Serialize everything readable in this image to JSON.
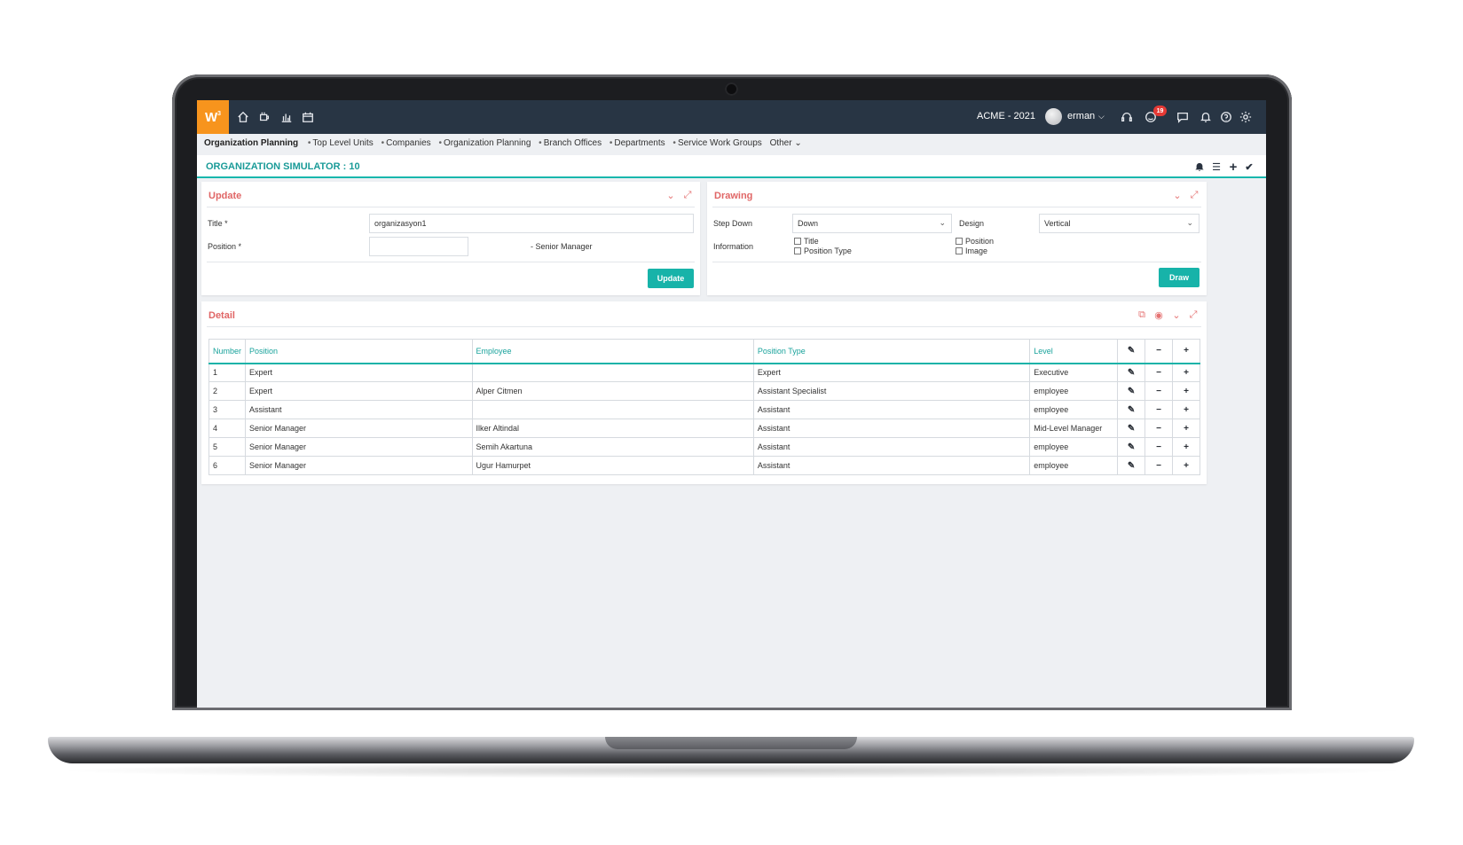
{
  "app": {
    "logo": "W",
    "logo_sup": "3",
    "company": "ACME - 2021",
    "user": "erman",
    "notification_count": "19"
  },
  "breadcrumb": {
    "items": [
      "Organization Planning",
      "Top Level Units",
      "Companies",
      "Organization Planning",
      "Branch Offices",
      "Departments",
      "Service Work Groups",
      "Other"
    ]
  },
  "page": {
    "title": "ORGANIZATION SIMULATOR : 10"
  },
  "update_panel": {
    "title": "Update",
    "title_label": "Title *",
    "title_value": "organizasyon1",
    "position_label": "Position *",
    "position_value": "",
    "position_text": "- Senior Manager",
    "button": "Update"
  },
  "drawing_panel": {
    "title": "Drawing",
    "step_down_label": "Step Down",
    "step_down_value": "Down",
    "design_label": "Design",
    "design_value": "Vertical",
    "information_label": "Information",
    "checkboxes": [
      "Title",
      "Position Type",
      "Position",
      "Image"
    ],
    "button": "Draw"
  },
  "detail_panel": {
    "title": "Detail",
    "columns": [
      "Number",
      "Position",
      "Employee",
      "Position Type",
      "Level"
    ],
    "rows": [
      {
        "number": "1",
        "position": "Expert",
        "employee": "",
        "position_type": "Expert",
        "level": "Executive"
      },
      {
        "number": "2",
        "position": "Expert",
        "employee": "Alper Citmen",
        "position_type": "Assistant Specialist",
        "level": "employee"
      },
      {
        "number": "3",
        "position": "Assistant",
        "employee": "",
        "position_type": "Assistant",
        "level": "employee"
      },
      {
        "number": "4",
        "position": "Senior Manager",
        "employee": "Ilker Altindal",
        "position_type": "Assistant",
        "level": "Mid-Level Manager"
      },
      {
        "number": "5",
        "position": "Senior Manager",
        "employee": "Semih Akartuna",
        "position_type": "Assistant",
        "level": "employee"
      },
      {
        "number": "6",
        "position": "Senior Manager",
        "employee": "Ugur Hamurpet",
        "position_type": "Assistant",
        "level": "employee"
      }
    ]
  },
  "icons": {
    "topbar_left": [
      "home-icon",
      "coffee-icon",
      "bar-chart-icon",
      "calendar-icon"
    ],
    "topbar_right": [
      "headset-icon",
      "smiley-icon",
      "chat-icon",
      "bell-icon",
      "help-icon",
      "gear-icon"
    ],
    "header": [
      "bell-icon",
      "list-icon",
      "plus-icon",
      "check-icon"
    ]
  },
  "colors": {
    "topbar": "#283544",
    "logo": "#f7941d",
    "accent": "#17b3a9",
    "panel_title": "#e06666",
    "badge": "#e53935"
  }
}
